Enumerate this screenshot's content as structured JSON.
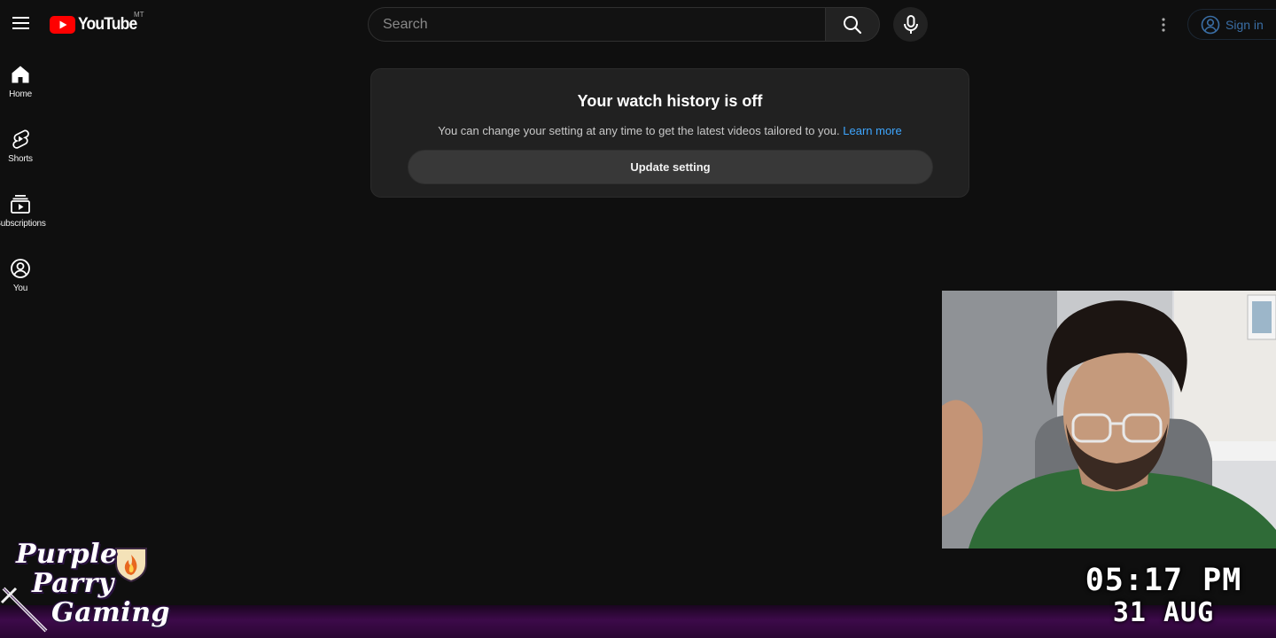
{
  "masthead": {
    "logo_text": "YouTube",
    "country_code": "MT",
    "search_placeholder": "Search",
    "sign_in_label": "Sign in"
  },
  "guide": {
    "items": [
      {
        "label": "Home",
        "icon": "home-icon"
      },
      {
        "label": "Shorts",
        "icon": "shorts-icon"
      },
      {
        "label": "Subscriptions",
        "icon": "subscriptions-icon"
      },
      {
        "label": "You",
        "icon": "you-icon"
      }
    ]
  },
  "history_card": {
    "title": "Your watch history is off",
    "description": "You can change your setting at any time to get the latest videos tailored to you.",
    "learn_more": "Learn more",
    "button_label": "Update setting"
  },
  "overlay": {
    "brand_line1": "Purple",
    "brand_line2": "Parry",
    "brand_line3": "Gaming",
    "time": "05:17 PM",
    "date": "31 AUG"
  },
  "colors": {
    "background": "#0f0f0f",
    "card": "#212121",
    "accent_red": "#ff0000",
    "link_blue": "#3ea6ff",
    "stream_purple": "#3d0a4a"
  }
}
